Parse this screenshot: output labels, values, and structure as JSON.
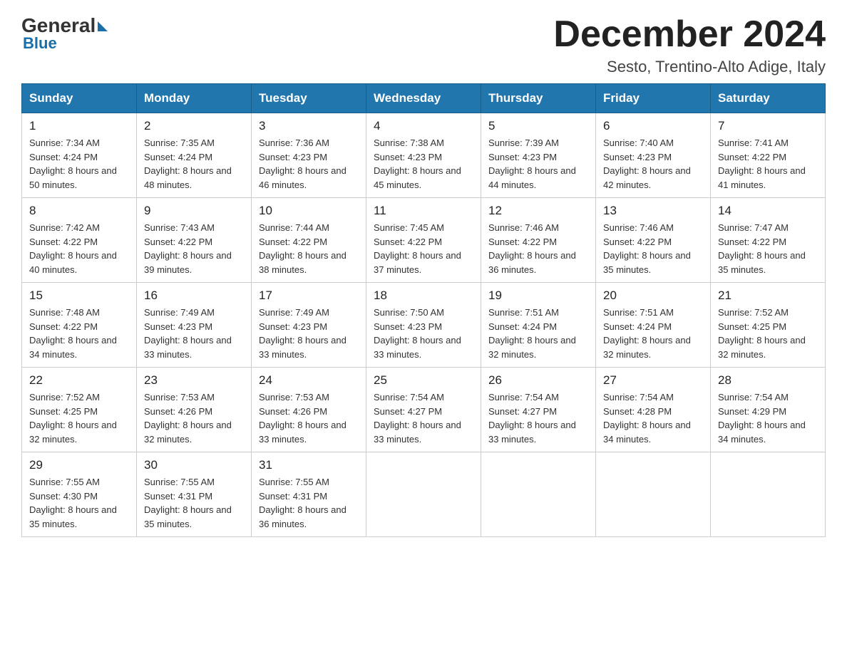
{
  "header": {
    "logo_general": "General",
    "logo_blue": "Blue",
    "month_title": "December 2024",
    "location": "Sesto, Trentino-Alto Adige, Italy"
  },
  "days_of_week": [
    "Sunday",
    "Monday",
    "Tuesday",
    "Wednesday",
    "Thursday",
    "Friday",
    "Saturday"
  ],
  "weeks": [
    [
      {
        "day": "1",
        "sunrise": "7:34 AM",
        "sunset": "4:24 PM",
        "daylight": "8 hours and 50 minutes."
      },
      {
        "day": "2",
        "sunrise": "7:35 AM",
        "sunset": "4:24 PM",
        "daylight": "8 hours and 48 minutes."
      },
      {
        "day": "3",
        "sunrise": "7:36 AM",
        "sunset": "4:23 PM",
        "daylight": "8 hours and 46 minutes."
      },
      {
        "day": "4",
        "sunrise": "7:38 AM",
        "sunset": "4:23 PM",
        "daylight": "8 hours and 45 minutes."
      },
      {
        "day": "5",
        "sunrise": "7:39 AM",
        "sunset": "4:23 PM",
        "daylight": "8 hours and 44 minutes."
      },
      {
        "day": "6",
        "sunrise": "7:40 AM",
        "sunset": "4:23 PM",
        "daylight": "8 hours and 42 minutes."
      },
      {
        "day": "7",
        "sunrise": "7:41 AM",
        "sunset": "4:22 PM",
        "daylight": "8 hours and 41 minutes."
      }
    ],
    [
      {
        "day": "8",
        "sunrise": "7:42 AM",
        "sunset": "4:22 PM",
        "daylight": "8 hours and 40 minutes."
      },
      {
        "day": "9",
        "sunrise": "7:43 AM",
        "sunset": "4:22 PM",
        "daylight": "8 hours and 39 minutes."
      },
      {
        "day": "10",
        "sunrise": "7:44 AM",
        "sunset": "4:22 PM",
        "daylight": "8 hours and 38 minutes."
      },
      {
        "day": "11",
        "sunrise": "7:45 AM",
        "sunset": "4:22 PM",
        "daylight": "8 hours and 37 minutes."
      },
      {
        "day": "12",
        "sunrise": "7:46 AM",
        "sunset": "4:22 PM",
        "daylight": "8 hours and 36 minutes."
      },
      {
        "day": "13",
        "sunrise": "7:46 AM",
        "sunset": "4:22 PM",
        "daylight": "8 hours and 35 minutes."
      },
      {
        "day": "14",
        "sunrise": "7:47 AM",
        "sunset": "4:22 PM",
        "daylight": "8 hours and 35 minutes."
      }
    ],
    [
      {
        "day": "15",
        "sunrise": "7:48 AM",
        "sunset": "4:22 PM",
        "daylight": "8 hours and 34 minutes."
      },
      {
        "day": "16",
        "sunrise": "7:49 AM",
        "sunset": "4:23 PM",
        "daylight": "8 hours and 33 minutes."
      },
      {
        "day": "17",
        "sunrise": "7:49 AM",
        "sunset": "4:23 PM",
        "daylight": "8 hours and 33 minutes."
      },
      {
        "day": "18",
        "sunrise": "7:50 AM",
        "sunset": "4:23 PM",
        "daylight": "8 hours and 33 minutes."
      },
      {
        "day": "19",
        "sunrise": "7:51 AM",
        "sunset": "4:24 PM",
        "daylight": "8 hours and 32 minutes."
      },
      {
        "day": "20",
        "sunrise": "7:51 AM",
        "sunset": "4:24 PM",
        "daylight": "8 hours and 32 minutes."
      },
      {
        "day": "21",
        "sunrise": "7:52 AM",
        "sunset": "4:25 PM",
        "daylight": "8 hours and 32 minutes."
      }
    ],
    [
      {
        "day": "22",
        "sunrise": "7:52 AM",
        "sunset": "4:25 PM",
        "daylight": "8 hours and 32 minutes."
      },
      {
        "day": "23",
        "sunrise": "7:53 AM",
        "sunset": "4:26 PM",
        "daylight": "8 hours and 32 minutes."
      },
      {
        "day": "24",
        "sunrise": "7:53 AM",
        "sunset": "4:26 PM",
        "daylight": "8 hours and 33 minutes."
      },
      {
        "day": "25",
        "sunrise": "7:54 AM",
        "sunset": "4:27 PM",
        "daylight": "8 hours and 33 minutes."
      },
      {
        "day": "26",
        "sunrise": "7:54 AM",
        "sunset": "4:27 PM",
        "daylight": "8 hours and 33 minutes."
      },
      {
        "day": "27",
        "sunrise": "7:54 AM",
        "sunset": "4:28 PM",
        "daylight": "8 hours and 34 minutes."
      },
      {
        "day": "28",
        "sunrise": "7:54 AM",
        "sunset": "4:29 PM",
        "daylight": "8 hours and 34 minutes."
      }
    ],
    [
      {
        "day": "29",
        "sunrise": "7:55 AM",
        "sunset": "4:30 PM",
        "daylight": "8 hours and 35 minutes."
      },
      {
        "day": "30",
        "sunrise": "7:55 AM",
        "sunset": "4:31 PM",
        "daylight": "8 hours and 35 minutes."
      },
      {
        "day": "31",
        "sunrise": "7:55 AM",
        "sunset": "4:31 PM",
        "daylight": "8 hours and 36 minutes."
      },
      null,
      null,
      null,
      null
    ]
  ]
}
